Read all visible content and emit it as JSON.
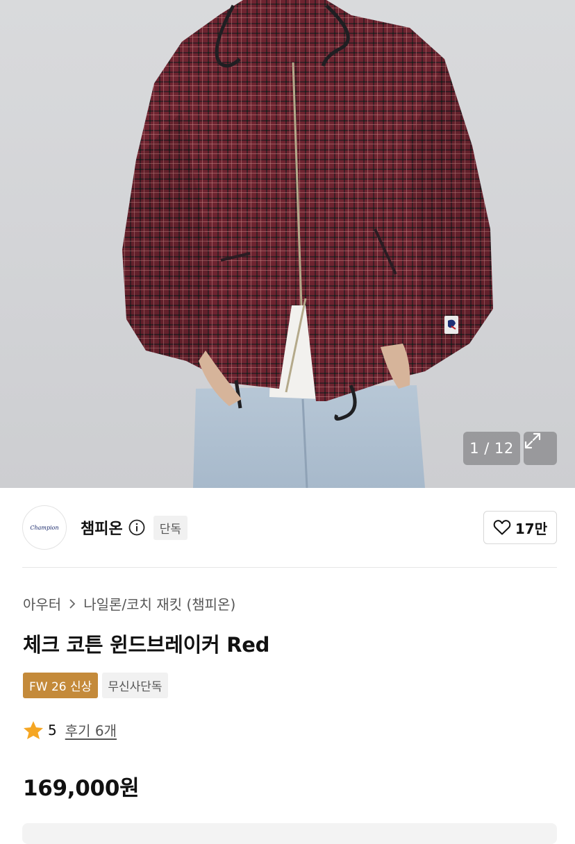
{
  "gallery": {
    "counter": "1 / 12",
    "icons": {
      "expand": "expand-icon"
    }
  },
  "brand": {
    "logo_text": "Champion",
    "name": "챔피온",
    "exclusive_badge": "단독",
    "likes": "17만",
    "icons": {
      "info": "info-icon",
      "like": "heart-icon"
    }
  },
  "product": {
    "breadcrumb": [
      "아우터",
      "나일론/코치 재킷 (챔피온)"
    ],
    "title": "체크 코튼 윈드브레이커 Red",
    "tags": {
      "new": "FW 26 신상",
      "exclusive": "무신사단독"
    },
    "rating": "5",
    "reviews": "후기 6개",
    "price": "169,000원"
  },
  "colors": {
    "accent": "#c48a3a",
    "star": "#f5a623",
    "jacket": "#6e2430"
  }
}
